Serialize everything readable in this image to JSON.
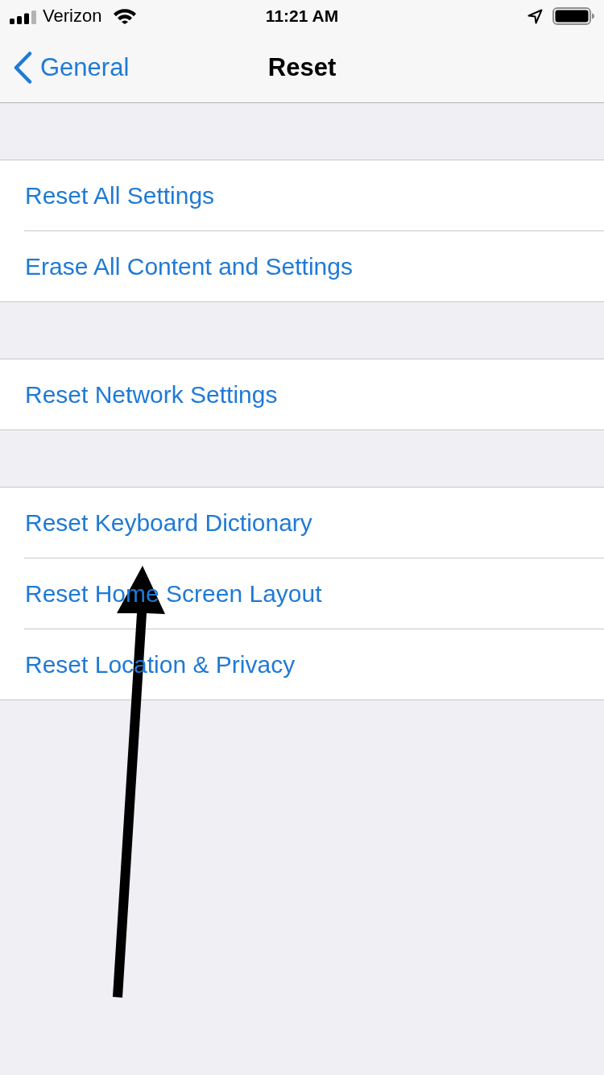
{
  "status_bar": {
    "carrier": "Verizon",
    "time": "11:21 AM"
  },
  "nav_bar": {
    "back_label": "General",
    "title": "Reset"
  },
  "groups": [
    {
      "items": [
        {
          "label": "Reset All Settings"
        },
        {
          "label": "Erase All Content and Settings"
        }
      ]
    },
    {
      "items": [
        {
          "label": "Reset Network Settings"
        }
      ]
    },
    {
      "items": [
        {
          "label": "Reset Keyboard Dictionary"
        },
        {
          "label": "Reset Home Screen Layout"
        },
        {
          "label": "Reset Location & Privacy"
        }
      ]
    }
  ]
}
